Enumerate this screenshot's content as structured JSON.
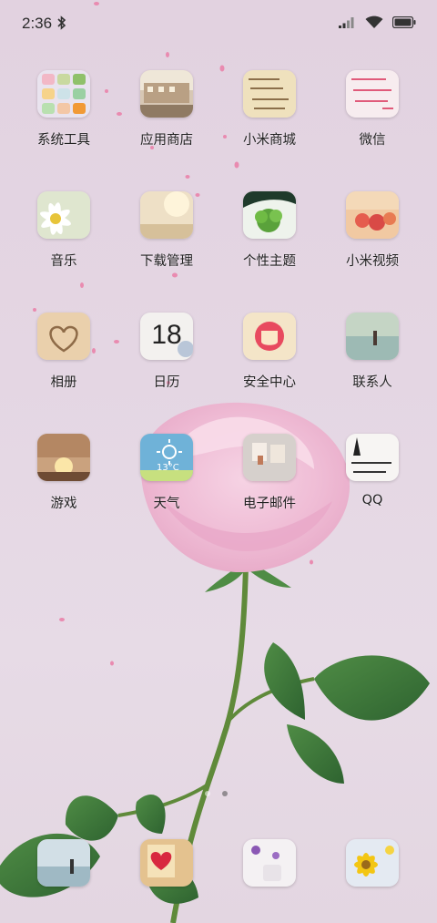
{
  "status_bar": {
    "time": "2:36",
    "icons": [
      "bluetooth-icon",
      "signal-icon",
      "wifi-icon",
      "battery-icon"
    ]
  },
  "apps": [
    {
      "label": "系统工具",
      "icon": "system-tools-folder-icon"
    },
    {
      "label": "应用商店",
      "icon": "app-store-icon"
    },
    {
      "label": "小米商城",
      "icon": "mi-store-icon"
    },
    {
      "label": "微信",
      "icon": "wechat-icon"
    },
    {
      "label": "音乐",
      "icon": "music-icon"
    },
    {
      "label": "下载管理",
      "icon": "download-manager-icon"
    },
    {
      "label": "个性主题",
      "icon": "themes-icon"
    },
    {
      "label": "小米视频",
      "icon": "mi-video-icon"
    },
    {
      "label": "相册",
      "icon": "gallery-icon"
    },
    {
      "label": "日历",
      "icon": "calendar-icon",
      "badge_text": "18"
    },
    {
      "label": "安全中心",
      "icon": "security-center-icon"
    },
    {
      "label": "联系人",
      "icon": "contacts-icon"
    },
    {
      "label": "游戏",
      "icon": "games-icon"
    },
    {
      "label": "天气",
      "icon": "weather-icon",
      "badge_text": "13°C"
    },
    {
      "label": "电子邮件",
      "icon": "email-icon"
    },
    {
      "label": "QQ",
      "icon": "qq-icon"
    }
  ],
  "dock": [
    {
      "icon": "phone-icon"
    },
    {
      "icon": "messages-icon"
    },
    {
      "icon": "browser-icon"
    },
    {
      "icon": "camera-icon"
    }
  ],
  "page_indicator": {
    "pages": 2,
    "current": 2
  },
  "colors": {
    "wallpaper": "#e3d4e1",
    "rose": "#f2c2d8",
    "stem": "#5f8a3a",
    "leaf": "#3f7a37"
  }
}
